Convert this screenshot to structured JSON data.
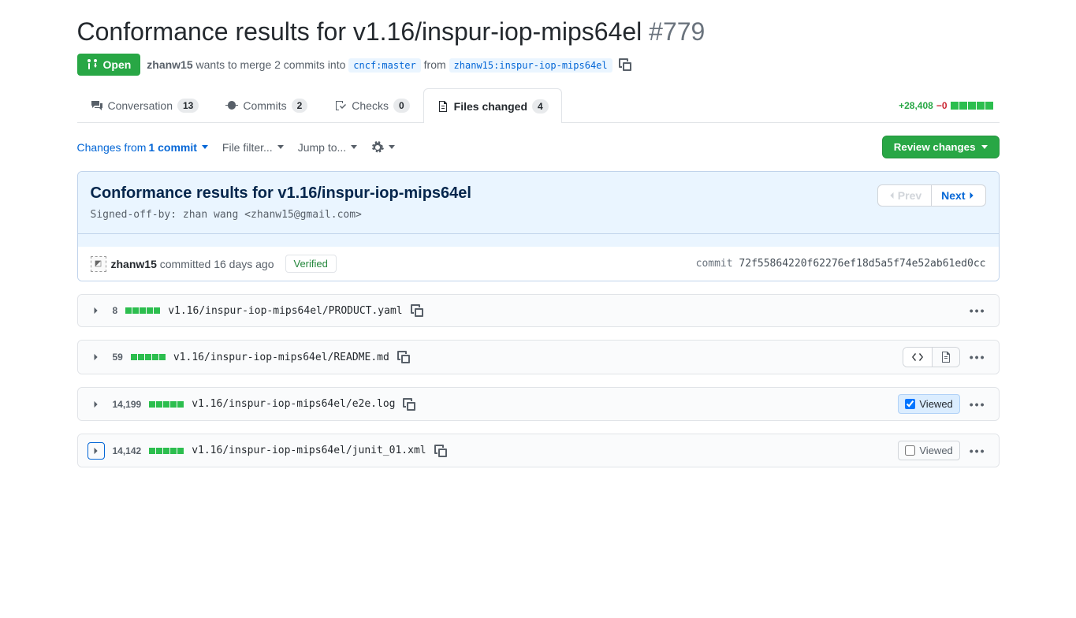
{
  "pr": {
    "title": "Conformance results for v1.16/inspur-iop-mips64el",
    "number": "#779",
    "state": "Open",
    "author": "zhanw15",
    "merge_text1": " wants to merge 2 commits into ",
    "base": "cncf:master",
    "merge_text2": " from ",
    "head": "zhanw15:inspur-iop-mips64el"
  },
  "tabs": {
    "conversation": {
      "label": "Conversation",
      "count": "13"
    },
    "commits": {
      "label": "Commits",
      "count": "2"
    },
    "checks": {
      "label": "Checks",
      "count": "0"
    },
    "files": {
      "label": "Files changed",
      "count": "4"
    }
  },
  "diffstat": {
    "additions": "+28,408",
    "deletions": "−0"
  },
  "toolbar": {
    "changes_prefix": "Changes from ",
    "changes_bold": "1 commit",
    "file_filter": "File filter...",
    "jump_to": "Jump to...",
    "review_btn": "Review changes"
  },
  "commit": {
    "title": "Conformance results for v1.16/inspur-iop-mips64el",
    "body": "Signed-off-by: zhan wang <zhanw15@gmail.com>",
    "prev": "Prev",
    "next": "Next",
    "author": "zhanw15",
    "action_time": " committed 16 days ago",
    "verified": "Verified",
    "sha_label": "commit ",
    "sha": "72f55864220f62276ef18d5a5f74e52ab61ed0cc"
  },
  "files": [
    {
      "changes": "8",
      "path": "v1.16/inspur-iop-mips64el/PRODUCT.yaml",
      "blocks": [
        1,
        1,
        1,
        1,
        1
      ],
      "viewed_state": "none",
      "has_toggle": false,
      "selected": false
    },
    {
      "changes": "59",
      "path": "v1.16/inspur-iop-mips64el/README.md",
      "blocks": [
        1,
        1,
        1,
        1,
        1
      ],
      "viewed_state": "none",
      "has_toggle": true,
      "selected": false
    },
    {
      "changes": "14,199",
      "path": "v1.16/inspur-iop-mips64el/e2e.log",
      "blocks": [
        1,
        1,
        1,
        1,
        1
      ],
      "viewed_state": "checked",
      "has_toggle": false,
      "selected": false
    },
    {
      "changes": "14,142",
      "path": "v1.16/inspur-iop-mips64el/junit_01.xml",
      "blocks": [
        1,
        1,
        1,
        1,
        1
      ],
      "viewed_state": "unchecked",
      "has_toggle": false,
      "selected": true
    }
  ],
  "viewed_label": "Viewed"
}
